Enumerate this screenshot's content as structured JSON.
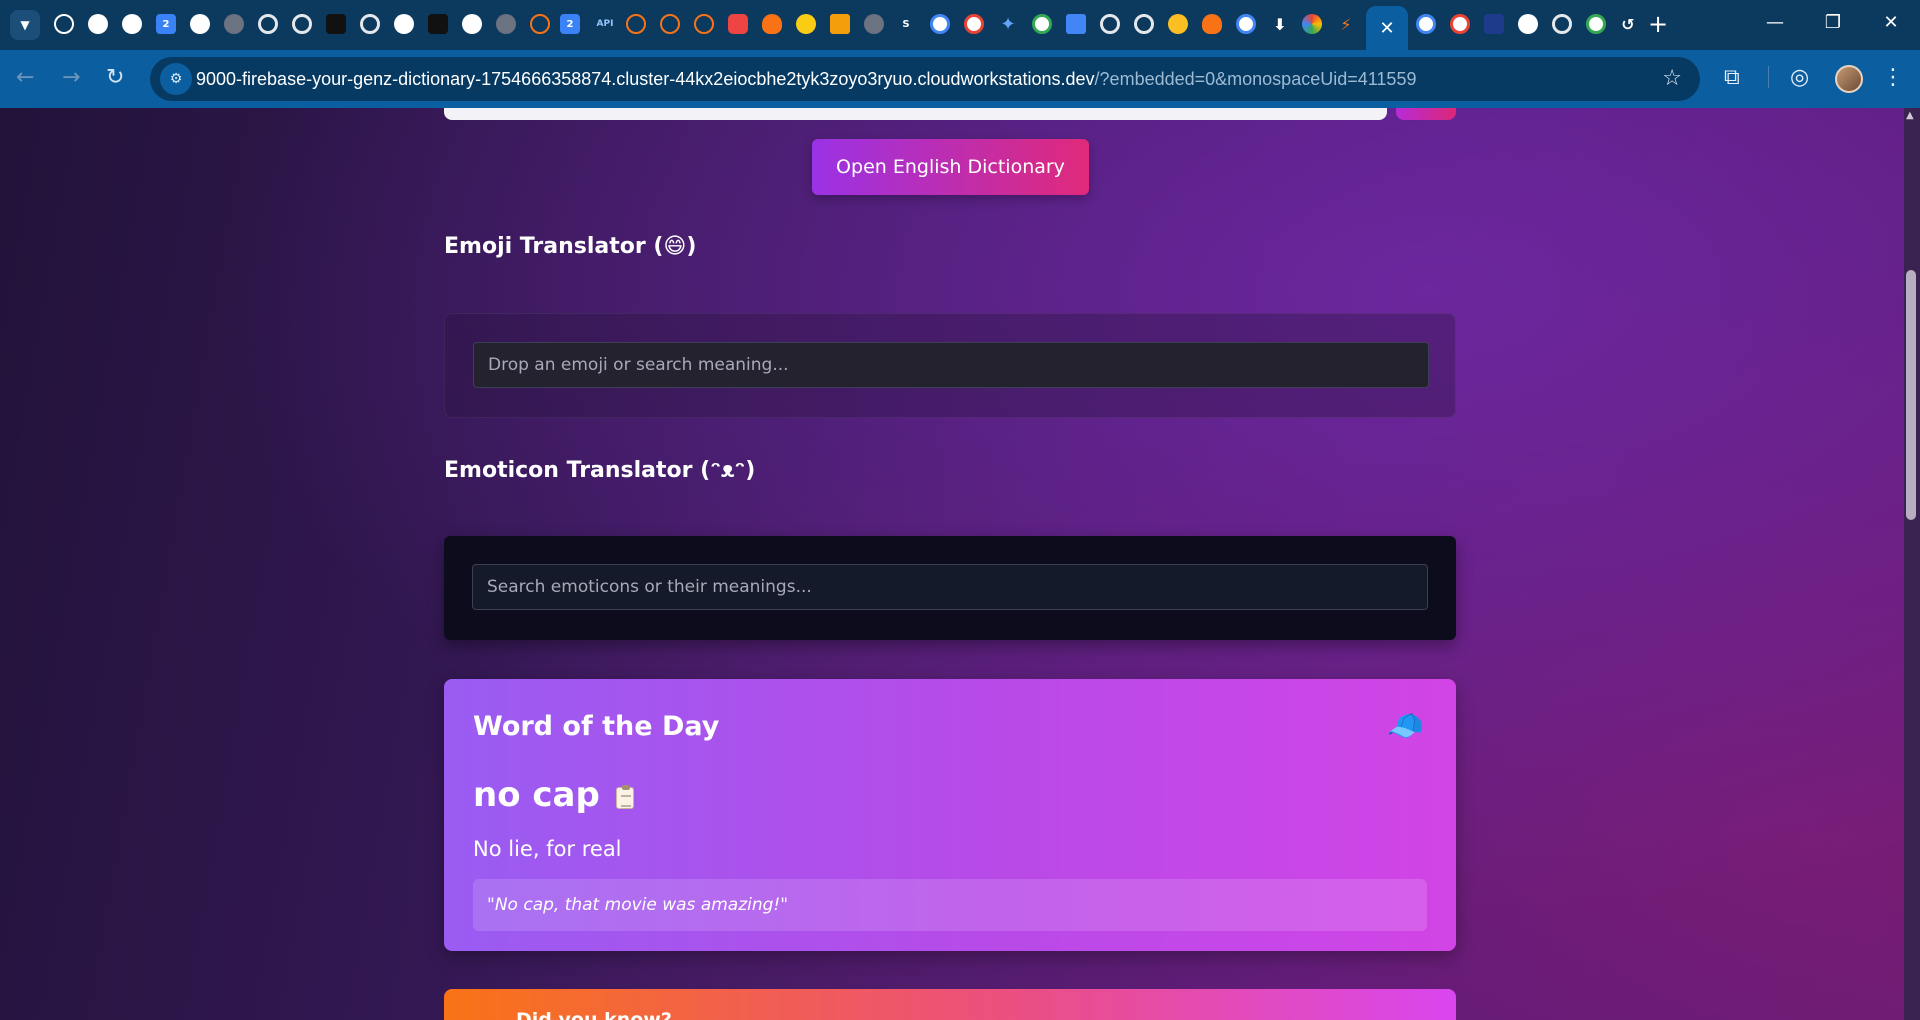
{
  "browser": {
    "url_main": "9000-firebase-your-genz-dictionary-1754666358874.cluster-44kx2eiocbhe2tyk3zoyo3ryuo.cloudworkstations.dev",
    "url_rest": "/?embedded=0&monospaceUid=411559",
    "tab_icon_labels": [
      "2",
      "2",
      "API",
      "S"
    ],
    "colors": {
      "tabstrip": "#0c3a5e",
      "toolbar": "#0b5fa0",
      "omnibox": "#063a63"
    }
  },
  "page": {
    "open_dictionary_label": "Open English Dictionary",
    "emoji_section": {
      "title": "Emoji Translator (😄)",
      "placeholder": "Drop an emoji or search meaning..."
    },
    "emoticon_section": {
      "title": "Emoticon Translator (ᵔᴥᵔ)",
      "placeholder": "Search emoticons or their meanings..."
    },
    "word_of_the_day": {
      "heading": "Word of the Day",
      "icon": "🧢",
      "word": "no cap",
      "meaning": "No lie, for real",
      "example": "\"No cap, that movie was amazing!\""
    },
    "fact_card": {
      "title": "Did you know?"
    },
    "colors": {
      "button_gradient_start": "#9a32e6",
      "button_gradient_end": "#e0297a",
      "wotd_gradient_start": "#9a5cf2",
      "wotd_gradient_end": "#d244e6",
      "fact_gradient_start": "#f97316",
      "fact_gradient_end": "#d946ef"
    }
  }
}
